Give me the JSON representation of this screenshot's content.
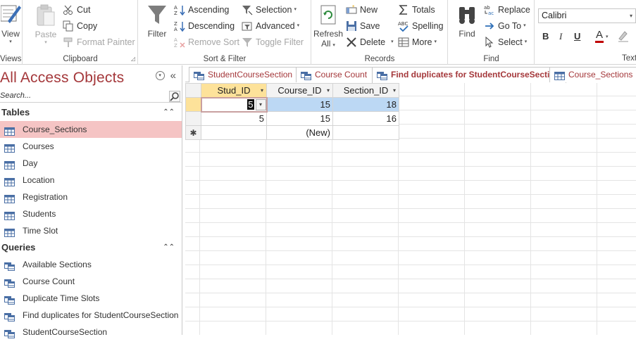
{
  "ribbon": {
    "views": {
      "view_label": "View",
      "group_label": "Views"
    },
    "clipboard": {
      "paste_label": "Paste",
      "cut_label": "Cut",
      "copy_label": "Copy",
      "format_painter_label": "Format Painter",
      "group_label": "Clipboard"
    },
    "sort_filter": {
      "filter_label": "Filter",
      "ascending_label": "Ascending",
      "descending_label": "Descending",
      "remove_sort_label": "Remove Sort",
      "selection_label": "Selection",
      "advanced_label": "Advanced",
      "toggle_filter_label": "Toggle Filter",
      "group_label": "Sort & Filter"
    },
    "records": {
      "refresh_label": "Refresh",
      "refresh_sub": "All",
      "new_label": "New",
      "save_label": "Save",
      "delete_label": "Delete",
      "totals_label": "Totals",
      "spelling_label": "Spelling",
      "more_label": "More",
      "group_label": "Records"
    },
    "find": {
      "find_label": "Find",
      "replace_label": "Replace",
      "goto_label": "Go To",
      "select_label": "Select",
      "group_label": "Find"
    },
    "text": {
      "font_name": "Calibri",
      "bold": "B",
      "italic": "I",
      "underline": "U",
      "font_color": "A",
      "group_label": "Text"
    }
  },
  "nav": {
    "title": "All Access Objects",
    "search_placeholder": "Search...",
    "sections": [
      {
        "label": "Tables",
        "items": [
          "Course_Sections",
          "Courses",
          "Day",
          "Location",
          "Registration",
          "Students",
          "Time Slot"
        ]
      },
      {
        "label": "Queries",
        "items": [
          "Available Sections",
          "Course Count",
          "Duplicate Time Slots",
          "Find duplicates for StudentCourseSection",
          "StudentCourseSection"
        ]
      }
    ]
  },
  "tabs": [
    {
      "label": "StudentCourseSection",
      "kind": "query"
    },
    {
      "label": "Course Count",
      "kind": "query"
    },
    {
      "label": "Find duplicates for StudentCourseSection",
      "kind": "query"
    },
    {
      "label": "Course_Sections",
      "kind": "table"
    }
  ],
  "datasheet": {
    "columns": [
      "Stud_ID",
      "Course_ID",
      "Section_ID"
    ],
    "rows": [
      [
        "5",
        "15",
        "18"
      ],
      [
        "5",
        "15",
        "16"
      ]
    ],
    "new_row_label": "(New)",
    "new_row_marker": "✱"
  },
  "colors": {
    "access_accent": "#a4373a",
    "header_fill": "#fde29a",
    "selected_nav": "#f5c4c4",
    "current_row": "#bcd8f4"
  }
}
